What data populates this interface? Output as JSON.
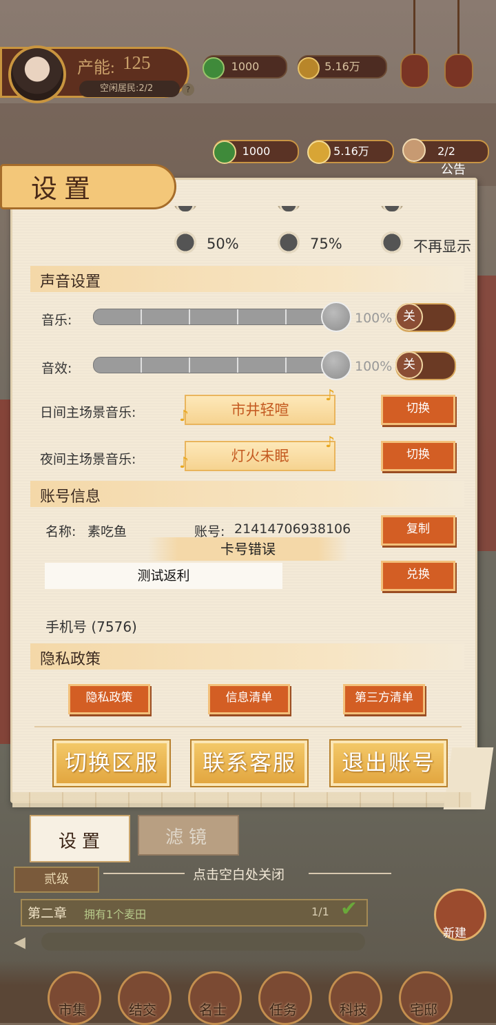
{
  "top_bar": {
    "capacity_label": "产能:",
    "capacity_value": "125",
    "idle_residents": "空闲居民:2/2",
    "help": "?",
    "copper": "1000",
    "gold": "5.16万"
  },
  "resource_row": {
    "copper": "1000",
    "gold": "5.16万",
    "residents": "2/2",
    "notice_label": "公告"
  },
  "panel": {
    "title": "设置",
    "radio_options": [
      "50%",
      "75%",
      "不再显示"
    ],
    "sound": {
      "section_title": "声音设置",
      "music_label": "音乐:",
      "music_value": "100%",
      "music_toggle": "关",
      "sfx_label": "音效:",
      "sfx_value": "100%",
      "sfx_toggle": "关",
      "day_music_label": "日间主场景音乐:",
      "day_music_value": "市井轻喧",
      "night_music_label": "夜间主场景音乐:",
      "night_music_value": "灯火未眠",
      "switch_label": "切换"
    },
    "account": {
      "section_title": "账号信息",
      "name_label": "名称:",
      "name_value": "素吃鱼",
      "account_label": "账号:",
      "account_value": "21414706938106",
      "copy_label": "复制",
      "error_text": "卡号错误",
      "code_value": "测试返利",
      "redeem_label": "兑换",
      "phone": "手机号 (7576)"
    },
    "privacy": {
      "section_title": "隐私政策",
      "buttons": [
        "隐私政策",
        "信息清单",
        "第三方清单"
      ]
    },
    "actions": [
      "切换区服",
      "联系客服",
      "退出账号"
    ]
  },
  "tabs": {
    "settings": "设置",
    "filter": "滤镜"
  },
  "hint": "点击空白处关闭",
  "quest": {
    "level": "贰级",
    "chapter": "第二章",
    "task": "拥有1个麦田",
    "progress": "1/1",
    "new_build": "新建"
  },
  "bottom_nav": [
    "市集",
    "结交",
    "名士",
    "任务",
    "科技",
    "宅邸"
  ]
}
